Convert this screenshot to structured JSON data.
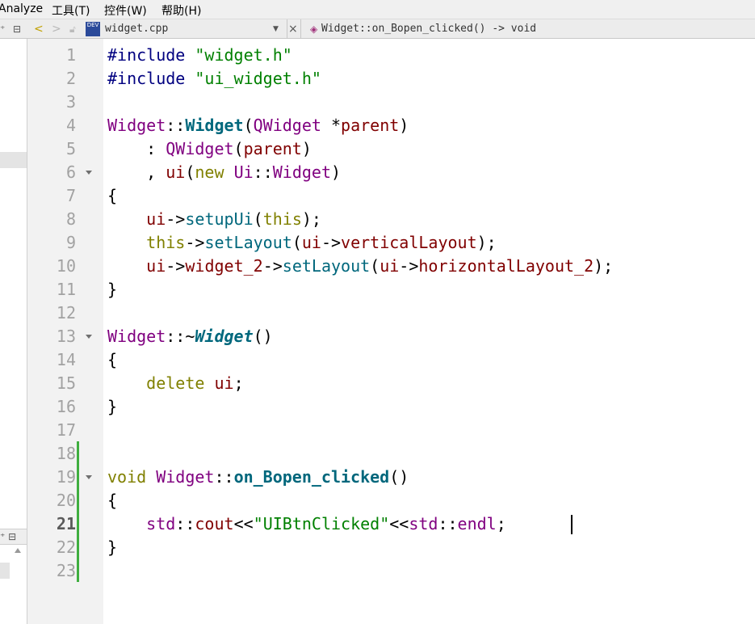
{
  "menu": {
    "analyze": "Analyze",
    "tools": "工具(T)",
    "controls": "控件(W)",
    "help": "帮助(H)"
  },
  "toolbar": {
    "file_name": "widget.cpp",
    "symbol": "Widget::on_Bopen_clicked() -> void",
    "file_badge": "DEV"
  },
  "editor": {
    "current_line": "21",
    "lines": [
      {
        "n": "1"
      },
      {
        "n": "2"
      },
      {
        "n": "3"
      },
      {
        "n": "4"
      },
      {
        "n": "5"
      },
      {
        "n": "6"
      },
      {
        "n": "7"
      },
      {
        "n": "8"
      },
      {
        "n": "9"
      },
      {
        "n": "10"
      },
      {
        "n": "11"
      },
      {
        "n": "12"
      },
      {
        "n": "13"
      },
      {
        "n": "14"
      },
      {
        "n": "15"
      },
      {
        "n": "16"
      },
      {
        "n": "17"
      },
      {
        "n": "18"
      },
      {
        "n": "19"
      },
      {
        "n": "20"
      },
      {
        "n": "21"
      },
      {
        "n": "22"
      },
      {
        "n": "23"
      }
    ],
    "code": [
      [
        [
          "pp",
          "#include "
        ],
        [
          "str",
          "\"widget.h\""
        ]
      ],
      [
        [
          "pp",
          "#include "
        ],
        [
          "str",
          "\"ui_widget.h\""
        ]
      ],
      [],
      [
        [
          "cls",
          "Widget"
        ],
        [
          "op",
          "::"
        ],
        [
          "fnb",
          "Widget"
        ],
        [
          "op",
          "("
        ],
        [
          "cls",
          "QWidget"
        ],
        [
          "op",
          " *"
        ],
        [
          "mem",
          "parent"
        ],
        [
          "op",
          ")"
        ]
      ],
      [
        [
          "op",
          "    : "
        ],
        [
          "cls",
          "QWidget"
        ],
        [
          "op",
          "("
        ],
        [
          "mem",
          "parent"
        ],
        [
          "op",
          ")"
        ]
      ],
      [
        [
          "op",
          "    , "
        ],
        [
          "mem",
          "ui"
        ],
        [
          "op",
          "("
        ],
        [
          "kw",
          "new "
        ],
        [
          "cls",
          "Ui"
        ],
        [
          "op",
          "::"
        ],
        [
          "cls",
          "Widget"
        ],
        [
          "op",
          ")"
        ]
      ],
      [
        [
          "op",
          "{"
        ]
      ],
      [
        [
          "op",
          "    "
        ],
        [
          "mem",
          "ui"
        ],
        [
          "op",
          "->"
        ],
        [
          "fn",
          "setupUi"
        ],
        [
          "op",
          "("
        ],
        [
          "kw",
          "this"
        ],
        [
          "op",
          ");"
        ]
      ],
      [
        [
          "op",
          "    "
        ],
        [
          "kw",
          "this"
        ],
        [
          "op",
          "->"
        ],
        [
          "fn",
          "setLayout"
        ],
        [
          "op",
          "("
        ],
        [
          "mem",
          "ui"
        ],
        [
          "op",
          "->"
        ],
        [
          "mem",
          "verticalLayout"
        ],
        [
          "op",
          ");"
        ]
      ],
      [
        [
          "op",
          "    "
        ],
        [
          "mem",
          "ui"
        ],
        [
          "op",
          "->"
        ],
        [
          "mem",
          "widget_2"
        ],
        [
          "op",
          "->"
        ],
        [
          "fn",
          "setLayout"
        ],
        [
          "op",
          "("
        ],
        [
          "mem",
          "ui"
        ],
        [
          "op",
          "->"
        ],
        [
          "mem",
          "horizontalLayout_2"
        ],
        [
          "op",
          ");"
        ]
      ],
      [
        [
          "op",
          "}"
        ]
      ],
      [],
      [
        [
          "cls",
          "Widget"
        ],
        [
          "op",
          "::~"
        ],
        [
          "fni",
          "Widget"
        ],
        [
          "op",
          "()"
        ]
      ],
      [
        [
          "op",
          "{"
        ]
      ],
      [
        [
          "op",
          "    "
        ],
        [
          "kw",
          "delete "
        ],
        [
          "mem",
          "ui"
        ],
        [
          "op",
          ";"
        ]
      ],
      [
        [
          "op",
          "}"
        ]
      ],
      [],
      [],
      [
        [
          "kw",
          "void "
        ],
        [
          "cls",
          "Widget"
        ],
        [
          "op",
          "::"
        ],
        [
          "fnb",
          "on_Bopen_clicked"
        ],
        [
          "op",
          "()"
        ]
      ],
      [
        [
          "op",
          "{"
        ]
      ],
      [
        [
          "op",
          "    "
        ],
        [
          "cls",
          "std"
        ],
        [
          "op",
          "::"
        ],
        [
          "mem",
          "cout"
        ],
        [
          "op",
          "<<"
        ],
        [
          "str",
          "\"UIBtnClicked\""
        ],
        [
          "op",
          "<<"
        ],
        [
          "cls",
          "std"
        ],
        [
          "op",
          "::"
        ],
        [
          "cls",
          "endl"
        ],
        [
          "op",
          ";"
        ]
      ],
      [
        [
          "op",
          "}"
        ]
      ],
      []
    ],
    "fold_lines": [
      6,
      13,
      19
    ]
  }
}
